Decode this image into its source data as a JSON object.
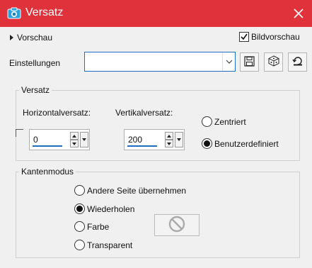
{
  "window": {
    "title": "Versatz",
    "close_icon": "close-icon",
    "app_icon": "camera-icon"
  },
  "top": {
    "preview_label": "Vorschau",
    "bildvorschau_label": "Bildvorschau",
    "bildvorschau_checked": true,
    "settings_label": "Einstellungen",
    "settings_value": "",
    "tool_icons": [
      "save-icon",
      "dice-icon",
      "reset-icon"
    ]
  },
  "versatz": {
    "title": "Versatz",
    "horizontal_label": "Horizontalversatz:",
    "horizontal_value": "0",
    "vertical_label": "Vertikalversatz:",
    "vertical_value": "200",
    "options": [
      "Zentriert",
      "Benutzerdefiniert"
    ],
    "selected": "Benutzerdefiniert"
  },
  "kantenmodus": {
    "title": "Kantenmodus",
    "options": [
      "Andere Seite übernehmen",
      "Wiederholen",
      "Farbe",
      "Transparent"
    ],
    "selected": "Wiederholen",
    "color_swatch_icon": "no-color-icon"
  }
}
